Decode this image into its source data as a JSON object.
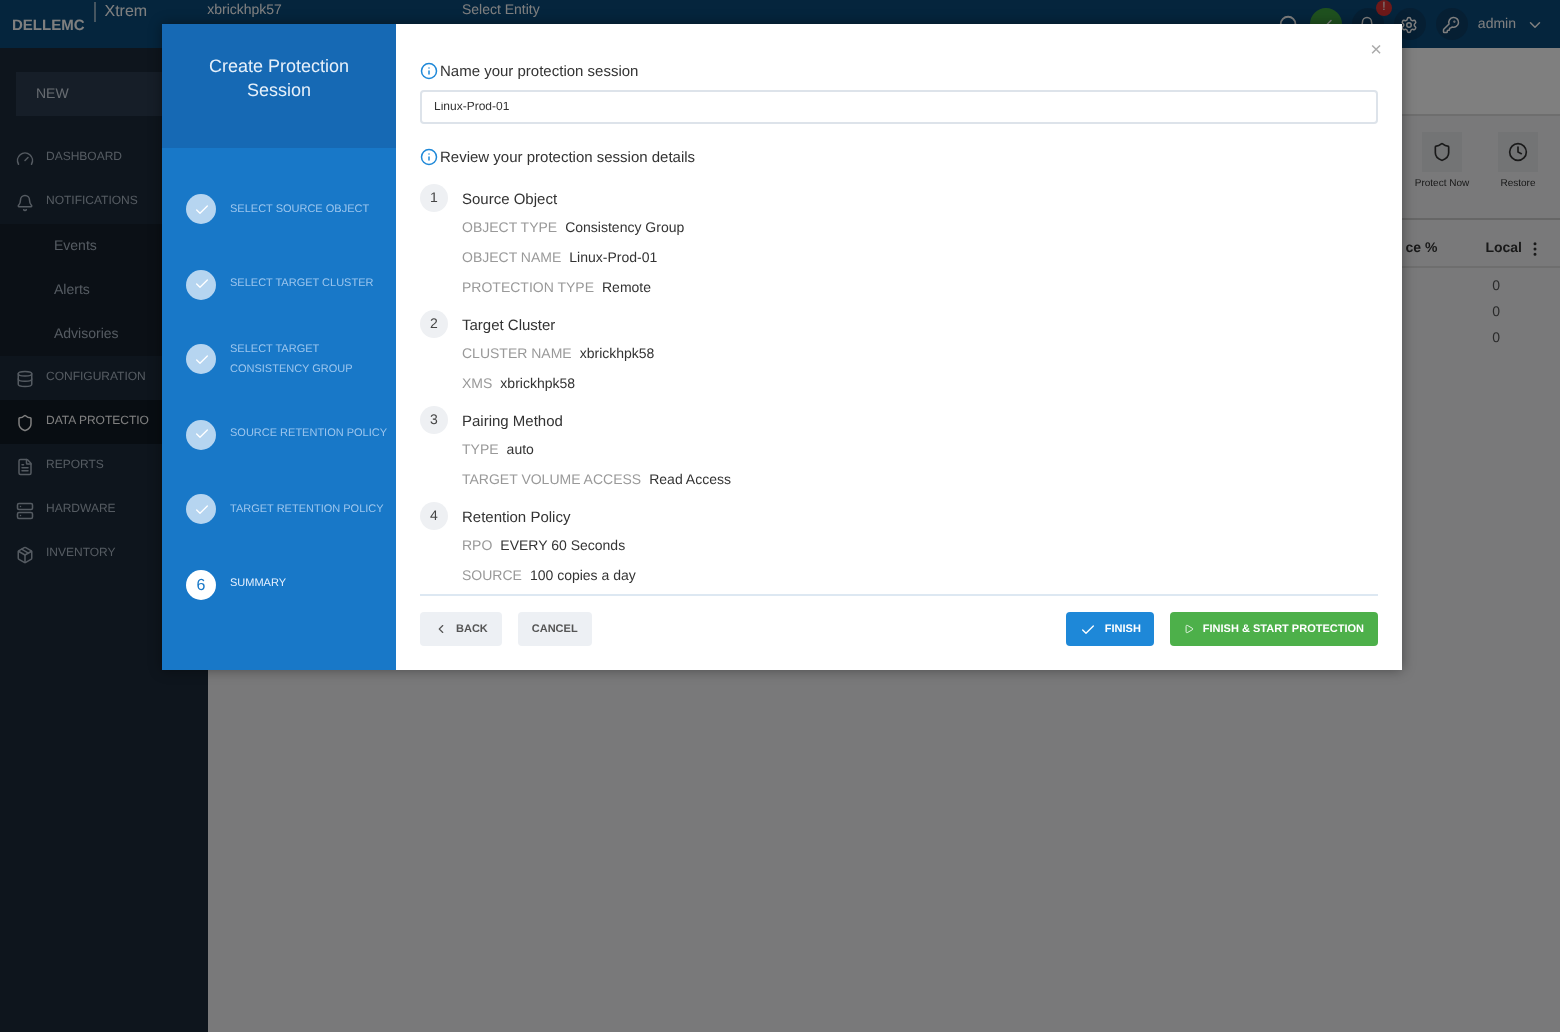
{
  "app": {
    "logo_brand": "DELLEMC",
    "logo_product": "Xtrem",
    "cluster": "xbrickhpk57",
    "entity": "Select Entity",
    "alert_badge": "!",
    "user": "admin"
  },
  "sidebar": {
    "new_button": "NEW",
    "items": [
      {
        "label": "DASHBOARD",
        "kind": "section",
        "selected": false
      },
      {
        "label": "NOTIFICATIONS",
        "kind": "section",
        "selected": false
      },
      {
        "label": "Events",
        "kind": "sub",
        "selected": false
      },
      {
        "label": "Alerts",
        "kind": "sub",
        "selected": false
      },
      {
        "label": "Advisories",
        "kind": "sub",
        "selected": false
      },
      {
        "label": "CONFIGURATION",
        "kind": "section",
        "selected": false
      },
      {
        "label": "DATA PROTECTIO",
        "kind": "section",
        "selected": true
      },
      {
        "label": "REPORTS",
        "kind": "section",
        "selected": false
      },
      {
        "label": "HARDWARE",
        "kind": "section",
        "selected": false
      },
      {
        "label": "INVENTORY",
        "kind": "section",
        "selected": false
      }
    ]
  },
  "content": {
    "toolbar": [
      {
        "label": "Protect Now"
      },
      {
        "label": "Restore"
      }
    ],
    "table": {
      "columns": [
        "ce %",
        "Local"
      ],
      "local_values": [
        "0",
        "0",
        "0"
      ]
    }
  },
  "dialog": {
    "title": "Create Protection Session",
    "close": "×",
    "steps": [
      {
        "label": "SELECT SOURCE OBJECT",
        "done": true,
        "selected": false
      },
      {
        "label": "SELECT TARGET CLUSTER",
        "done": true,
        "selected": false
      },
      {
        "label": "SELECT TARGET CONSISTENCY GROUP",
        "done": true,
        "selected": false
      },
      {
        "label": "SOURCE RETENTION POLICY",
        "done": true,
        "selected": false
      },
      {
        "label": "TARGET RETENTION POLICY",
        "done": true,
        "selected": false
      },
      {
        "label": "SUMMARY",
        "done": false,
        "number": "6",
        "selected": true
      }
    ],
    "name_label": "Name your protection session",
    "name_value": "Linux-Prod-01",
    "review_label": "Review your protection session details",
    "sections": [
      {
        "number": "1",
        "title": "Source Object",
        "fields": [
          {
            "label": "OBJECT TYPE",
            "value": "Consistency Group"
          },
          {
            "label": "OBJECT NAME",
            "value": "Linux-Prod-01"
          },
          {
            "label": "PROTECTION TYPE",
            "value": "Remote"
          }
        ]
      },
      {
        "number": "2",
        "title": "Target Cluster",
        "fields": [
          {
            "label": "CLUSTER NAME",
            "value": "xbrickhpk58"
          },
          {
            "label": "XMS",
            "value": "xbrickhpk58"
          }
        ]
      },
      {
        "number": "3",
        "title": "Pairing Method",
        "fields": [
          {
            "label": "TYPE",
            "value": "auto"
          },
          {
            "label": "TARGET VOLUME ACCESS",
            "value": "Read Access"
          }
        ]
      },
      {
        "number": "4",
        "title": "Retention Policy",
        "fields": [
          {
            "label": "RPO",
            "value": "EVERY 60 Seconds"
          },
          {
            "label": "SOURCE",
            "value": "100 copies a day"
          }
        ]
      }
    ],
    "buttons": {
      "back": "BACK",
      "cancel": "CANCEL",
      "finish": "FINISH",
      "finish_start": "FINISH & START PROTECTION"
    }
  }
}
